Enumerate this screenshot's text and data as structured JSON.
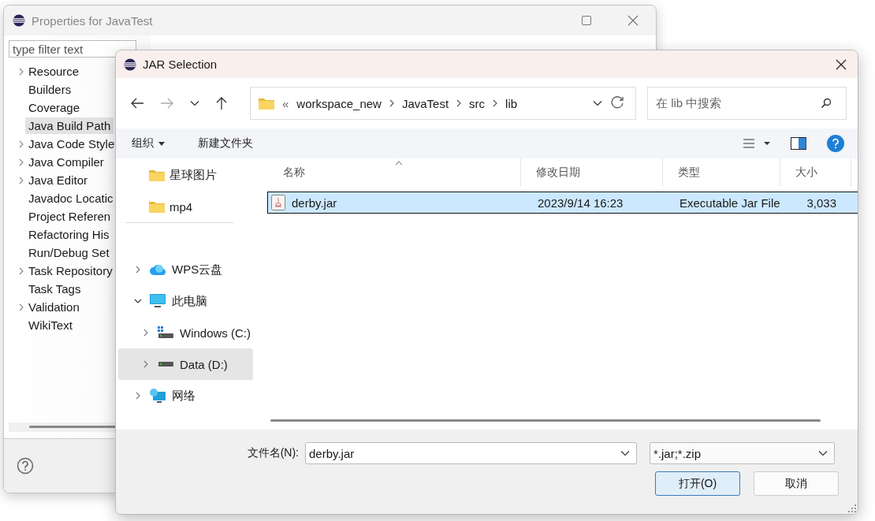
{
  "properties_window": {
    "title": "Properties for JavaTest",
    "filter": {
      "placeholder": "type filter text"
    },
    "tree": [
      {
        "label": "Resource",
        "expandable": true,
        "selected": false
      },
      {
        "label": "Builders",
        "expandable": false,
        "selected": false
      },
      {
        "label": "Coverage",
        "expandable": false,
        "selected": false
      },
      {
        "label": "Java Build Path",
        "expandable": false,
        "selected": true
      },
      {
        "label": "Java Code Style",
        "expandable": true,
        "selected": false
      },
      {
        "label": "Java Compiler",
        "expandable": true,
        "selected": false
      },
      {
        "label": "Java Editor",
        "expandable": true,
        "selected": false
      },
      {
        "label": "Javadoc Locatic",
        "expandable": false,
        "selected": false
      },
      {
        "label": "Project Referen",
        "expandable": false,
        "selected": false
      },
      {
        "label": "Refactoring His",
        "expandable": false,
        "selected": false
      },
      {
        "label": "Run/Debug Set",
        "expandable": false,
        "selected": false
      },
      {
        "label": "Task Repository",
        "expandable": true,
        "selected": false
      },
      {
        "label": "Task Tags",
        "expandable": false,
        "selected": false
      },
      {
        "label": "Validation",
        "expandable": true,
        "selected": false
      },
      {
        "label": "WikiText",
        "expandable": false,
        "selected": false
      }
    ]
  },
  "jar_dialog": {
    "title": "JAR Selection",
    "overflow_mark": "«",
    "breadcrumb": [
      "workspace_new",
      "JavaTest",
      "src",
      "lib"
    ],
    "search": {
      "placeholder": "在 lib 中搜索"
    },
    "toolbar": {
      "organize": "组织",
      "new_folder": "新建文件夹"
    },
    "quick_access": [
      {
        "label": "星球图片",
        "selected": false
      },
      {
        "label": "mp4",
        "selected": false
      }
    ],
    "nav_tree": [
      {
        "label": "WPS云盘",
        "kind": "cloud",
        "expanded": false,
        "selected": false
      },
      {
        "label": "此电脑",
        "kind": "computer",
        "expanded": true,
        "selected": false,
        "children": [
          {
            "label": "Windows (C:)",
            "kind": "system-drive",
            "expanded": false,
            "selected": false
          },
          {
            "label": "Data (D:)",
            "kind": "drive",
            "expanded": false,
            "selected": true
          }
        ]
      },
      {
        "label": "网络",
        "kind": "network",
        "expanded": false,
        "selected": false
      }
    ],
    "columns": [
      "名称",
      "修改日期",
      "类型",
      "大小"
    ],
    "files": [
      {
        "name": "derby.jar",
        "modified": "2023/9/14 16:23",
        "type": "Executable Jar File",
        "size": "3,033",
        "selected": true
      }
    ],
    "file_name_label": "文件名(N):",
    "file_name": "derby.jar",
    "file_type": "*.jar;*.zip",
    "buttons": [
      {
        "label": "打开(O)",
        "default": true
      },
      {
        "label": "取消",
        "default": false
      }
    ]
  }
}
